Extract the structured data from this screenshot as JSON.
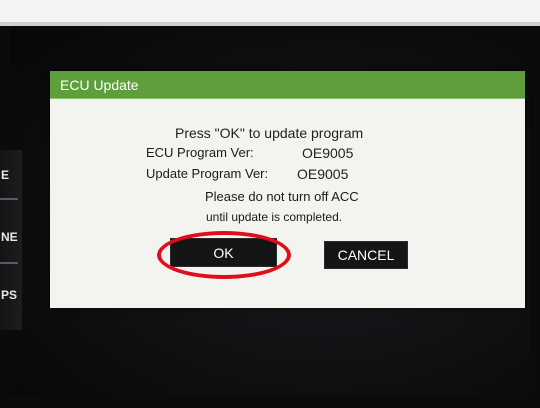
{
  "side_menu": {
    "items": [
      "E",
      "NE",
      "PS"
    ]
  },
  "dialog": {
    "title": "ECU Update",
    "headline": "Press \"OK\" to update program",
    "ecu_label": "ECU Program Ver:",
    "ecu_value": "OE9005",
    "update_label": "Update Program Ver:",
    "update_value": "OE9005",
    "warning_line1": "Please do not turn off ACC",
    "warning_line2": "until update is completed.",
    "ok_label": "OK",
    "cancel_label": "CANCEL"
  },
  "colors": {
    "header_green": "#5f9e3c",
    "highlight_red": "#e20d1a",
    "button_dark": "#151515"
  }
}
